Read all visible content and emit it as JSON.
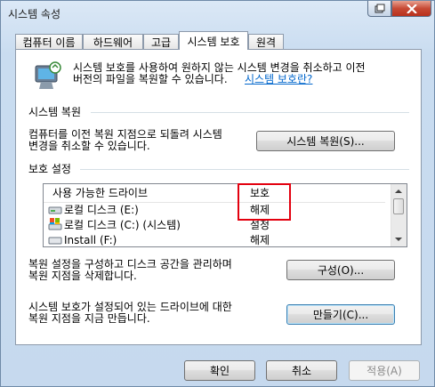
{
  "window": {
    "title": "시스템 속성"
  },
  "tabs": [
    {
      "label": "컴퓨터 이름"
    },
    {
      "label": "하드웨어"
    },
    {
      "label": "고급"
    },
    {
      "label": "시스템 보호"
    },
    {
      "label": "원격"
    }
  ],
  "intro": {
    "line1": "시스템 보호를 사용하여 원하지 않는 시스템 변경을 취소하고 이전",
    "line2_prefix": "버전의 파일을 복원할 수 있습니다.",
    "link": "시스템 보호란?"
  },
  "restore": {
    "heading": "시스템 복원",
    "line1": "컴퓨터를 이전 복원 지점으로 되돌려 시스템",
    "line2": "변경을 취소할 수 있습니다.",
    "button": "시스템 복원(S)..."
  },
  "protection": {
    "heading": "보호 설정",
    "col_drive": "사용 가능한 드라이브",
    "col_protection": "보호",
    "rows": [
      {
        "drive": "로컬 디스크 (E:)",
        "status": "해제"
      },
      {
        "drive": "로컬 디스크 (C:) (시스템)",
        "status": "설정"
      },
      {
        "drive": "Install (F:)",
        "status": "해제"
      }
    ]
  },
  "configure": {
    "line1": "복원 설정을 구성하고 디스크 공간을 관리하며",
    "line2": "복원 지점을 삭제합니다.",
    "button": "구성(O)..."
  },
  "create": {
    "line1": "시스템 보호가 설정되어 있는 드라이브에 대한",
    "line2": "복원 지점을 지금 만듭니다.",
    "button": "만들기(C)..."
  },
  "footer": {
    "ok": "확인",
    "cancel": "취소",
    "apply": "적용(A)"
  },
  "colors": {
    "highlight_box": "#e3000f",
    "link": "#0066cc"
  }
}
